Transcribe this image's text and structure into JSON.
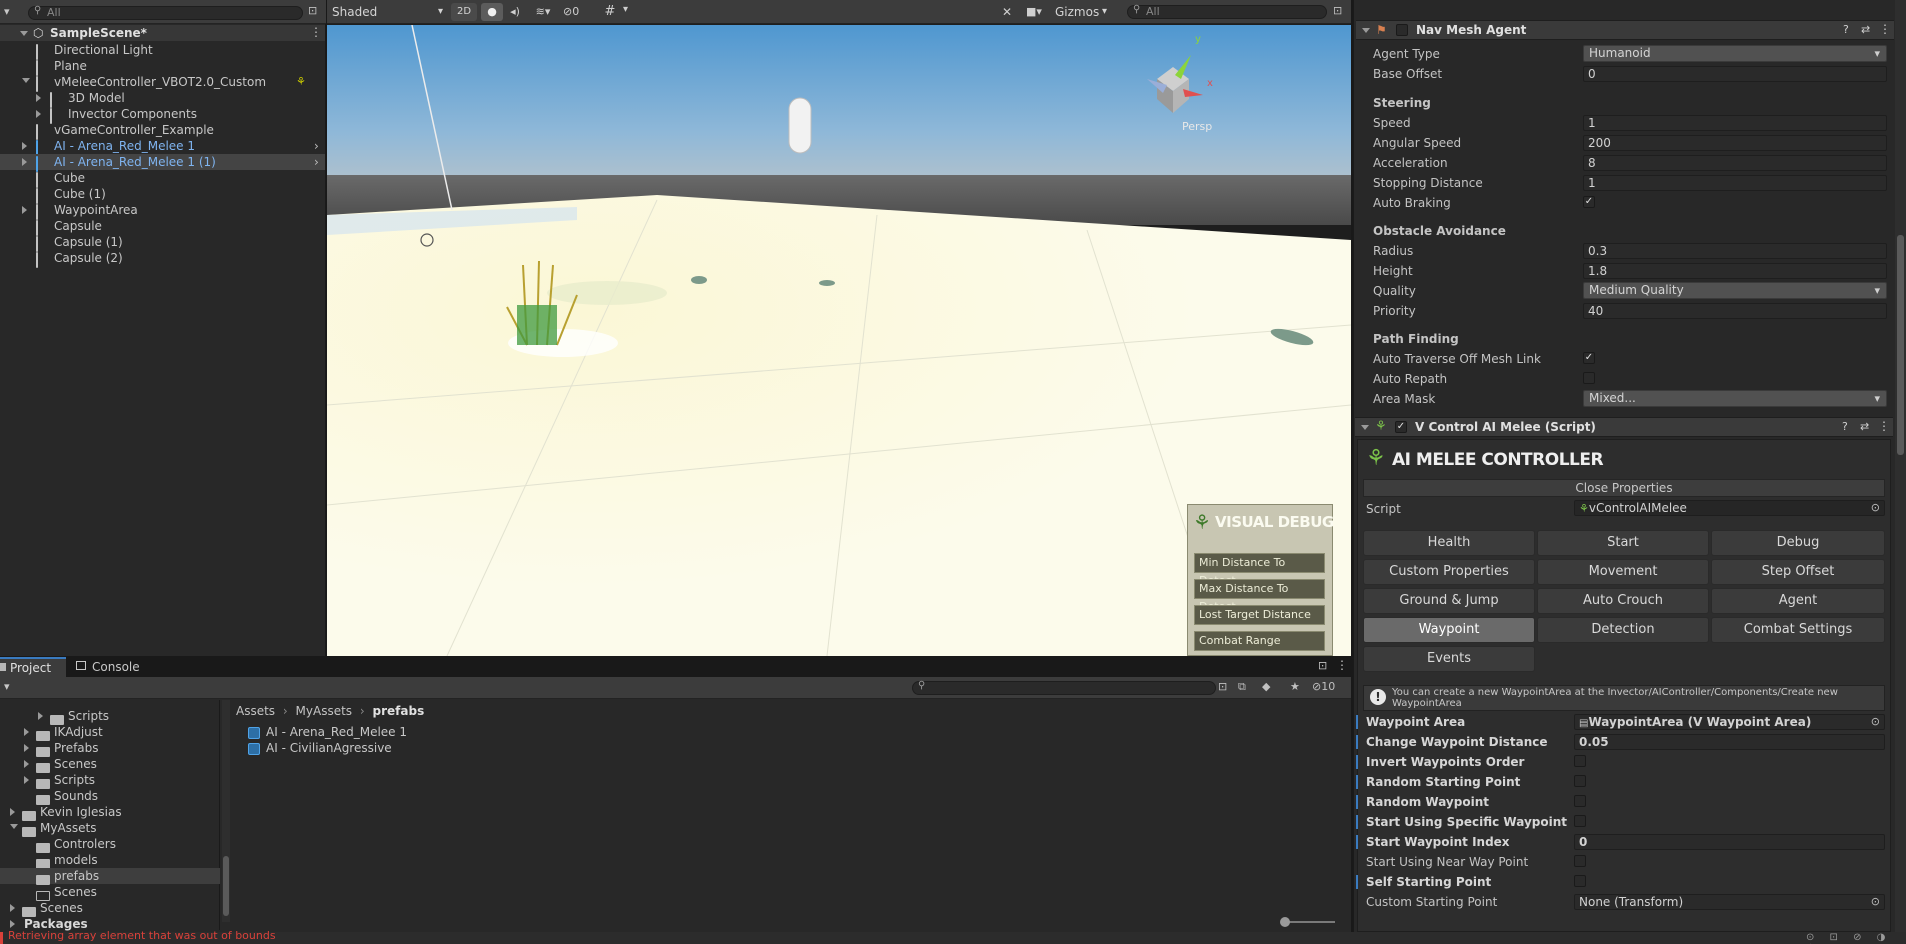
{
  "hierarchy": {
    "tab": "Hierarchy",
    "search_placeholder": "All",
    "scene": "SampleScene*",
    "items": [
      {
        "label": "Directional Light",
        "indent": 1,
        "arrow": "",
        "type": "obj"
      },
      {
        "label": "Plane",
        "indent": 1,
        "arrow": "",
        "type": "obj"
      },
      {
        "label": "vMeleeController_VBOT2.0_Custom",
        "indent": 1,
        "arrow": "down",
        "type": "obj"
      },
      {
        "label": "3D Model",
        "indent": 2,
        "arrow": "right",
        "type": "obj"
      },
      {
        "label": "Invector Components",
        "indent": 2,
        "arrow": "right",
        "type": "obj"
      },
      {
        "label": "vGameController_Example",
        "indent": 1,
        "arrow": "",
        "type": "obj"
      },
      {
        "label": "AI - Arena_Red_Melee 1",
        "indent": 1,
        "arrow": "right",
        "type": "prefab"
      },
      {
        "label": "AI - Arena_Red_Melee 1 (1)",
        "indent": 1,
        "arrow": "right",
        "type": "prefab"
      },
      {
        "label": "Cube",
        "indent": 1,
        "arrow": "",
        "type": "obj"
      },
      {
        "label": "Cube (1)",
        "indent": 1,
        "arrow": "",
        "type": "obj"
      },
      {
        "label": "WaypointArea",
        "indent": 1,
        "arrow": "right",
        "type": "obj"
      },
      {
        "label": "Capsule",
        "indent": 1,
        "arrow": "",
        "type": "obj"
      },
      {
        "label": "Capsule (1)",
        "indent": 1,
        "arrow": "",
        "type": "obj"
      },
      {
        "label": "Capsule (2)",
        "indent": 1,
        "arrow": "",
        "type": "obj"
      }
    ]
  },
  "scene_toolbar": {
    "shading": "Shaded",
    "mode_2d": "2D",
    "hidden_count": "0",
    "gizmos": "Gizmos",
    "search_placeholder": "All",
    "persp": "Persp"
  },
  "visual_debug": {
    "title": "VISUAL DEBUG",
    "buttons": [
      "Min Distance To Detect",
      "Max Distance To Detect",
      "Lost Target Distance",
      "Combat Range"
    ]
  },
  "project": {
    "tabs": [
      "Project",
      "Console"
    ],
    "tree": [
      {
        "label": "Scripts",
        "indent": 2,
        "arrow": "right"
      },
      {
        "label": "IKAdjust",
        "indent": 1,
        "arrow": "right"
      },
      {
        "label": "Prefabs",
        "indent": 1,
        "arrow": "right"
      },
      {
        "label": "Scenes",
        "indent": 1,
        "arrow": "right"
      },
      {
        "label": "Scripts",
        "indent": 1,
        "arrow": "right"
      },
      {
        "label": "Sounds",
        "indent": 1,
        "arrow": ""
      },
      {
        "label": "Kevin Iglesias",
        "indent": 0,
        "arrow": "right"
      },
      {
        "label": "MyAssets",
        "indent": 0,
        "arrow": "down"
      },
      {
        "label": "Controlers",
        "indent": 1,
        "arrow": ""
      },
      {
        "label": "models",
        "indent": 1,
        "arrow": ""
      },
      {
        "label": "prefabs",
        "indent": 1,
        "arrow": "",
        "selected": true
      },
      {
        "label": "Scenes",
        "indent": 1,
        "arrow": "",
        "empty": true
      },
      {
        "label": "Scenes",
        "indent": 0,
        "arrow": "right"
      }
    ],
    "packages": "Packages",
    "breadcrumb": [
      "Assets",
      "MyAssets",
      "prefabs"
    ],
    "files": [
      "AI - Arena_Red_Melee 1",
      "AI - CivilianAgressive"
    ],
    "hidden_count": "10",
    "status": "Retrieving array element that was out of bounds"
  },
  "nav_mesh_agent": {
    "title": "Nav Mesh Agent",
    "agent_type_label": "Agent Type",
    "agent_type": "Humanoid",
    "base_offset_label": "Base Offset",
    "base_offset": "0",
    "steering": "Steering",
    "speed_label": "Speed",
    "speed": "1",
    "angular_speed_label": "Angular Speed",
    "angular_speed": "200",
    "acceleration_label": "Acceleration",
    "acceleration": "8",
    "stopping_distance_label": "Stopping Distance",
    "stopping_distance": "1",
    "auto_braking_label": "Auto Braking",
    "obstacle_avoidance": "Obstacle Avoidance",
    "radius_label": "Radius",
    "radius": "0.3",
    "height_label": "Height",
    "height": "1.8",
    "quality_label": "Quality",
    "quality": "Medium Quality",
    "priority_label": "Priority",
    "priority": "40",
    "path_finding": "Path Finding",
    "auto_traverse_label": "Auto Traverse Off Mesh Link",
    "auto_repath_label": "Auto Repath",
    "area_mask_label": "Area Mask",
    "area_mask": "Mixed..."
  },
  "ai_melee": {
    "component_title": "V Control AI Melee (Script)",
    "banner": "AI MELEE CONTROLLER",
    "close_properties": "Close Properties",
    "script_label": "Script",
    "script_value": "vControlAIMelee",
    "buttons": [
      "Health",
      "Start",
      "Debug",
      "Custom Properties",
      "Movement",
      "Step Offset",
      "Ground & Jump",
      "Auto Crouch",
      "Agent",
      "Waypoint",
      "Detection",
      "Combat Settings",
      "Events"
    ],
    "info": "You can create a new WaypointArea at the Invector/AIController/Components/Create new WaypointArea",
    "waypoint_area_label": "Waypoint Area",
    "waypoint_area": "WaypointArea (V Waypoint Area)",
    "change_wp_label": "Change Waypoint Distance",
    "change_wp": "0.05",
    "invert_label": "Invert Waypoints Order",
    "random_start_label": "Random Starting Point",
    "random_wp_label": "Random Waypoint",
    "specific_label": "Start Using Specific Waypoint",
    "start_index_label": "Start Waypoint Index",
    "start_index": "0",
    "near_label": "Start Using Near Way Point",
    "self_start_label": "Self Starting Point",
    "custom_start_label": "Custom Starting Point",
    "custom_start": "None (Transform)"
  },
  "colors": {
    "accent": "#3a7bc0",
    "prefab_blue": "#7fb4f0",
    "error_red": "#d9413a"
  }
}
